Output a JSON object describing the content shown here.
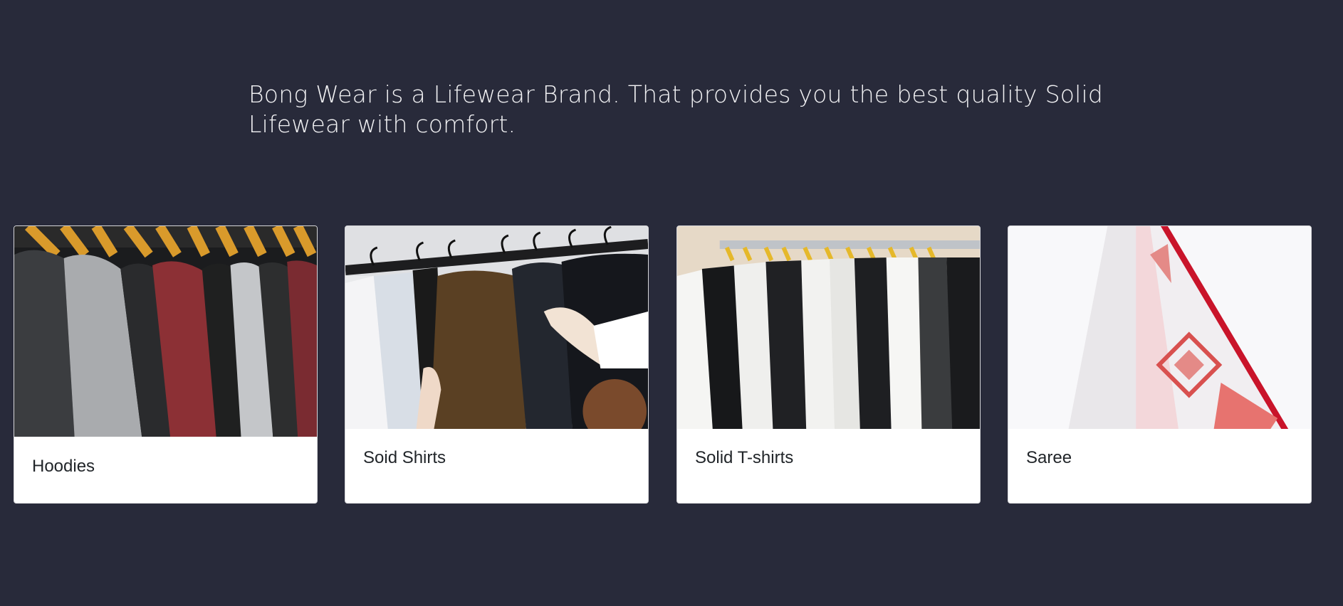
{
  "intro": {
    "text": "Bong Wear is a Lifewear Brand. That provides you the best quality Solid Lifewear with comfort."
  },
  "cards": [
    {
      "title": "Hoodies",
      "image": "hoodies-on-rack-photo"
    },
    {
      "title": "Soid Shirts",
      "image": "shirts-on-rack-photo"
    },
    {
      "title": "Solid T-shirts",
      "image": "tshirts-on-rack-photo"
    },
    {
      "title": "Saree",
      "image": "saree-photo"
    }
  ],
  "colors": {
    "background": "#282a3a",
    "card": "#ffffff",
    "text": "#f2f2f4"
  }
}
